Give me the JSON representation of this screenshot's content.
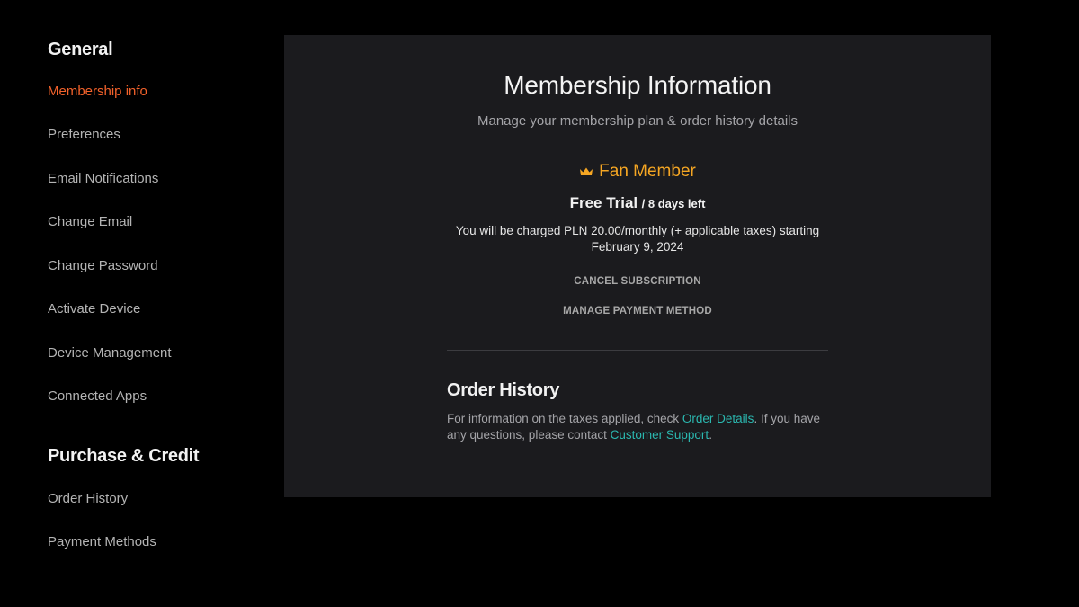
{
  "sidebar": {
    "sections": [
      {
        "title": "General",
        "items": [
          {
            "label": "Membership info",
            "active": true
          },
          {
            "label": "Preferences"
          },
          {
            "label": "Email Notifications"
          },
          {
            "label": "Change Email"
          },
          {
            "label": "Change Password"
          },
          {
            "label": "Activate Device"
          },
          {
            "label": "Device Management"
          },
          {
            "label": "Connected Apps"
          }
        ]
      },
      {
        "title": "Purchase & Credit",
        "items": [
          {
            "label": "Order History"
          },
          {
            "label": "Payment Methods"
          }
        ]
      }
    ]
  },
  "main": {
    "title": "Membership Information",
    "subtitle": "Manage your membership plan & order history details",
    "plan": {
      "icon": "crown-icon",
      "name": "Fan Member",
      "status": "Free Trial",
      "remaining": "/ 8 days left",
      "charge_text": "You will be charged PLN 20.00/monthly (+ applicable taxes) starting February 9, 2024"
    },
    "actions": {
      "cancel": "CANCEL SUBSCRIPTION",
      "manage_payment": "MANAGE PAYMENT METHOD"
    },
    "order_history": {
      "title": "Order History",
      "text_1": "For information on the taxes applied, check ",
      "link_1": "Order Details",
      "text_2": ". If you have any questions, please contact ",
      "link_2": "Customer Support",
      "text_3": "."
    }
  },
  "colors": {
    "accent": "#f3622b",
    "plan": "#f5a623",
    "link": "#2bb8b0",
    "panel_bg": "#1b1b1e"
  }
}
